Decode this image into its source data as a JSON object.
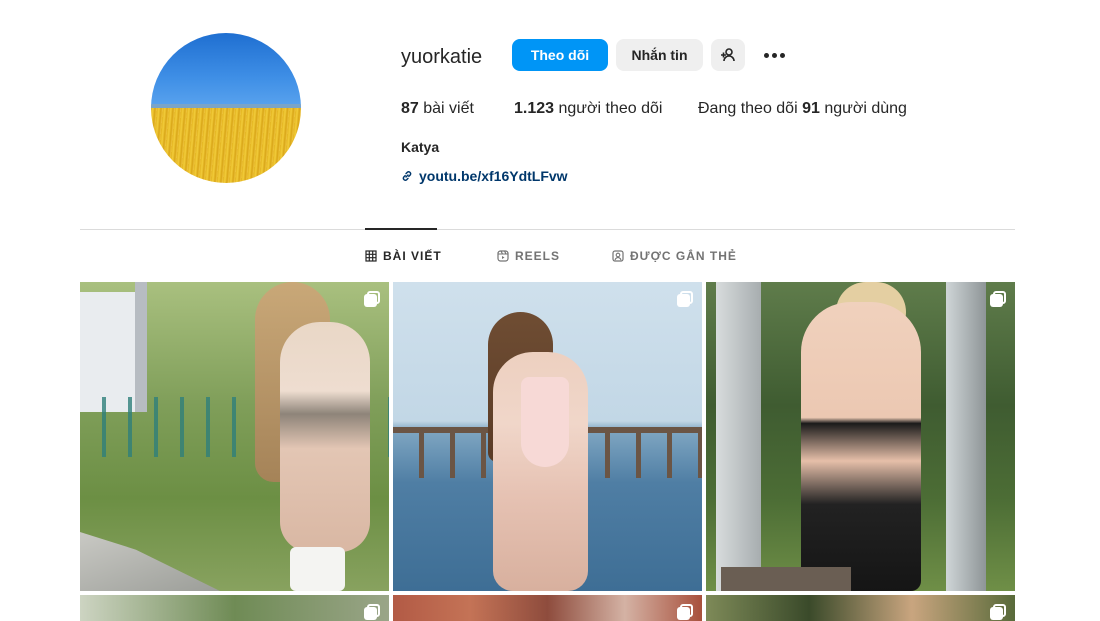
{
  "profile": {
    "username": "yuorkatie",
    "full_name": "Katya",
    "link": "youtu.be/xf16YdtLFvw"
  },
  "actions": {
    "follow_label": "Theo dõi",
    "message_label": "Nhắn tin",
    "add_user_icon": "person-add-icon",
    "more_icon": "more-horizontal-icon"
  },
  "stats": {
    "posts_count": "87",
    "posts_label": "bài viết",
    "followers_count": "1.123",
    "followers_label": "người theo dõi",
    "following_prefix": "Đang theo dõi",
    "following_count": "91",
    "following_suffix": "người dùng"
  },
  "tabs": [
    {
      "label": "BÀI VIẾT",
      "icon": "grid-icon",
      "active": true
    },
    {
      "label": "REELS",
      "icon": "reels-icon",
      "active": false
    },
    {
      "label": "ĐƯỢC GẮN THẺ",
      "icon": "tagged-icon",
      "active": false
    }
  ],
  "grid": {
    "multi_icon": "carousel-icon",
    "posts": [
      {
        "type": "carousel"
      },
      {
        "type": "carousel"
      },
      {
        "type": "carousel"
      },
      {
        "type": "carousel"
      },
      {
        "type": "carousel"
      },
      {
        "type": "carousel"
      }
    ]
  },
  "colors": {
    "accent": "#0095f6",
    "text": "#262626",
    "secondary_text": "#737373",
    "link": "#00376b",
    "button_gray": "#efefef",
    "divider": "#dbdbdb"
  }
}
